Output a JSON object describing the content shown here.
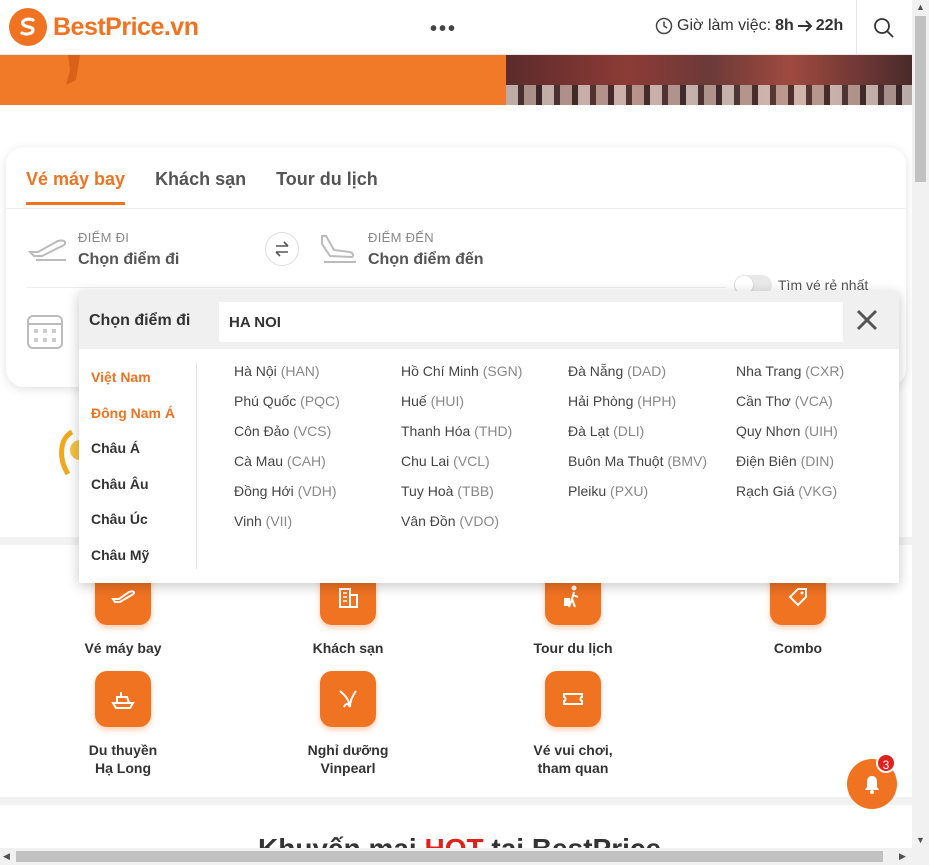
{
  "header": {
    "logo_text": "BestPrice.vn",
    "more_label": "•••",
    "hours_label": "Giờ làm việc:",
    "hours_from": "8h",
    "hours_to": "22h"
  },
  "search": {
    "tabs": [
      "Vé máy bay",
      "Khách sạn",
      "Tour du lịch"
    ],
    "from_label": "ĐIỂM ĐI",
    "from_value": "Chọn điểm đi",
    "to_label": "ĐIỂM ĐẾN",
    "to_value": "Chọn điểm đến",
    "cheapest_label": "Tìm vé rẻ nhất"
  },
  "dropdown": {
    "title": "Chọn điểm đi",
    "query": "HA NOI",
    "regions": [
      "Việt Nam",
      "Đông Nam Á",
      "Châu Á",
      "Châu Âu",
      "Châu Úc",
      "Châu Mỹ"
    ],
    "cities": [
      {
        "name": "Hà Nội",
        "code": "(HAN)"
      },
      {
        "name": "Hồ Chí Minh",
        "code": "(SGN)"
      },
      {
        "name": "Đà Nẵng",
        "code": "(DAD)"
      },
      {
        "name": "Nha Trang",
        "code": "(CXR)"
      },
      {
        "name": "Phú Quốc",
        "code": "(PQC)"
      },
      {
        "name": "Huế",
        "code": "(HUI)"
      },
      {
        "name": "Hải Phòng",
        "code": "(HPH)"
      },
      {
        "name": "Cần Thơ",
        "code": "(VCA)"
      },
      {
        "name": "Côn Đảo",
        "code": "(VCS)"
      },
      {
        "name": "Thanh Hóa",
        "code": "(THD)"
      },
      {
        "name": "Đà Lạt",
        "code": "(DLI)"
      },
      {
        "name": "Quy Nhơn",
        "code": "(UIH)"
      },
      {
        "name": "Cà Mau",
        "code": "(CAH)"
      },
      {
        "name": "Chu Lai",
        "code": "(VCL)"
      },
      {
        "name": "Buôn Ma Thuột",
        "code": "(BMV)"
      },
      {
        "name": "Điện Biên",
        "code": "(DIN)"
      },
      {
        "name": "Đồng Hới",
        "code": "(VDH)"
      },
      {
        "name": "Tuy Hoà",
        "code": "(TBB)"
      },
      {
        "name": "Pleiku",
        "code": "(PXU)"
      },
      {
        "name": "Rạch Giá",
        "code": "(VKG)"
      },
      {
        "name": "Vinh",
        "code": "(VII)"
      },
      {
        "name": "Vân Đồn",
        "code": "(VDO)"
      }
    ]
  },
  "categories": {
    "flight": "Vé máy bay",
    "hotel": "Khách sạn",
    "tour": "Tour du lịch",
    "combo": "Combo",
    "cruise_line1": "Du thuyền",
    "cruise_line2": "Hạ Long",
    "resort_line1": "Nghỉ dưỡng",
    "resort_line2": "Vinpearl",
    "tickets_line1": "Vé vui chơi,",
    "tickets_line2": "tham quan"
  },
  "promo": {
    "prefix": "Khuyến mại ",
    "hot": "HOT",
    "suffix": " tại BestPrice"
  },
  "chat": {
    "badge_count": "3"
  },
  "colors": {
    "brand": "#f07322",
    "hot": "#e0201d"
  }
}
